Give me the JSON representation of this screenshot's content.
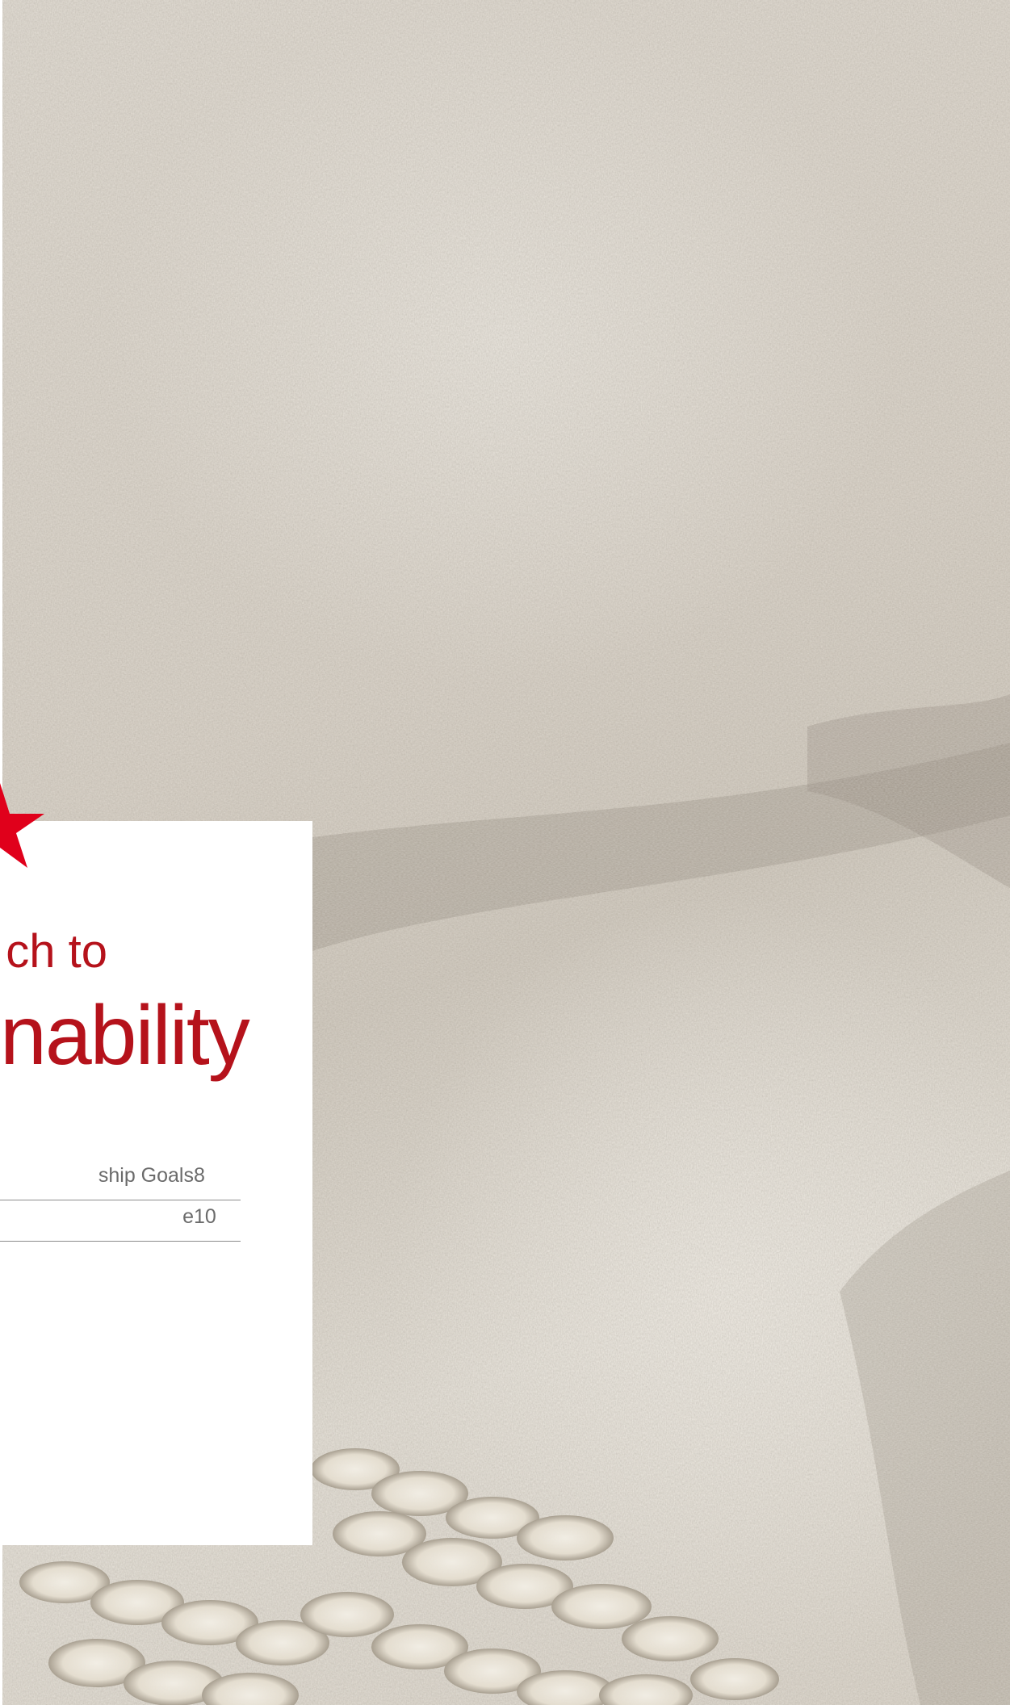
{
  "report": {
    "heading_line1": "ch to",
    "heading_line2": "nability"
  },
  "toc": [
    {
      "label": "ship Goals",
      "page": "8"
    },
    {
      "label": "e",
      "page": "10"
    }
  ],
  "colors": {
    "accent_red": "#b5121b",
    "star_red": "#e0001b",
    "card_white": "#ffffff",
    "fabric": "#d4ccc0"
  },
  "icons": {
    "brand_mark": "red-star-icon"
  }
}
